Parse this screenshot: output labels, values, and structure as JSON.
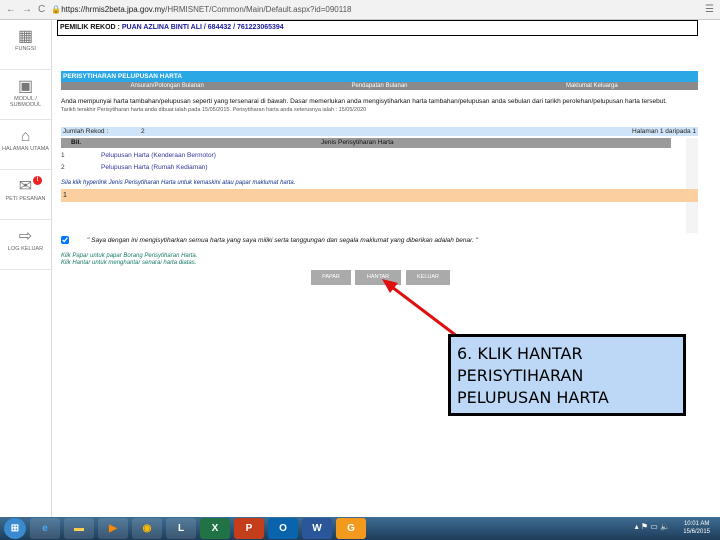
{
  "browser": {
    "url_host": "https://hrmis2beta.jpa.gov.my",
    "url_path": "/HRMISNET/Common/Main/Default.aspx?id=090118"
  },
  "sidebar": [
    {
      "label": "FUNGSI",
      "icon": "grid-icon"
    },
    {
      "label": "MODUL / SUBMODUL",
      "icon": "modules-icon"
    },
    {
      "label": "HALAMAN UTAMA",
      "icon": "home-icon"
    },
    {
      "label": "PETI PESANAN",
      "icon": "mail-icon",
      "badge": "!"
    },
    {
      "label": "LOG KELUAR",
      "icon": "logout-icon"
    }
  ],
  "owner": {
    "label": "PEMILIK REKOD :",
    "value": "PUAN AZLINA BINTI ALI / 684432 / 761223065394"
  },
  "section_title": "PERISYTIHARAN PELUPUSAN HARTA",
  "tabs": [
    "Ansuran/Potongan Bulanan",
    "Pendapatan Bulanan",
    "Maklumat Keluarga"
  ],
  "intro": {
    "text": "Anda mempunyai harta tambahan/pelupusan seperti yang tersenarai di bawah. Dasar memerlukan anda mengisytiharkan harta tambahan/pelupusan anda sebulan dari tarikh perolehan/pelupusan harta tersebut.",
    "dates": "Tarikh terakhir Perisytiharan harta anda dibuat ialah pada 15/05/2015. Perisytiharan harta anda seterusnya ialah : 15/05/2020"
  },
  "records": {
    "label": "Jumlah Rekod :",
    "count": "2",
    "page": "Halaman 1 daripada 1"
  },
  "table": {
    "headers": [
      "Bil.",
      "Jenis Perisytiharan Harta"
    ],
    "rows": [
      {
        "no": "1",
        "type": "Pelupusan Harta (Kenderaan Bermotor)"
      },
      {
        "no": "2",
        "type": "Pelupusan Harta (Rumah Kediaman)"
      }
    ]
  },
  "hint": "Sila klik hyperlink Jenis Perisytiharan Harta untuk kemaskini atau papar maklumat harta.",
  "pager": "1",
  "declaration": "\" Saya dengan ini mengisytiharkan semua harta yang saya miliki serta tanggungan dan segala maklumat yang diberikan adalah benar. \"",
  "instructions": [
    "Klik Papar untuk papar Borang Perisytiharan Harta.",
    "Klik Hantar untuk menghantar senarai harta diatas."
  ],
  "buttons": {
    "papar": "PAPAR",
    "hantar": "HANTAR",
    "keluar": "KELUAR"
  },
  "callout": "6. KLIK HANTAR PERISYTIHARAN PELUPUSAN HARTA",
  "taskbar": {
    "apps": [
      "start",
      "ie",
      "explorer",
      "media",
      "chrome",
      "lync",
      "excel",
      "powerpoint",
      "outlook",
      "word",
      "app"
    ],
    "time": "10:01 AM",
    "date": "15/6/2015"
  },
  "colors": {
    "accent": "#2aa8e6",
    "arrow": "#e01010",
    "callout_bg": "#bcd8f6"
  }
}
